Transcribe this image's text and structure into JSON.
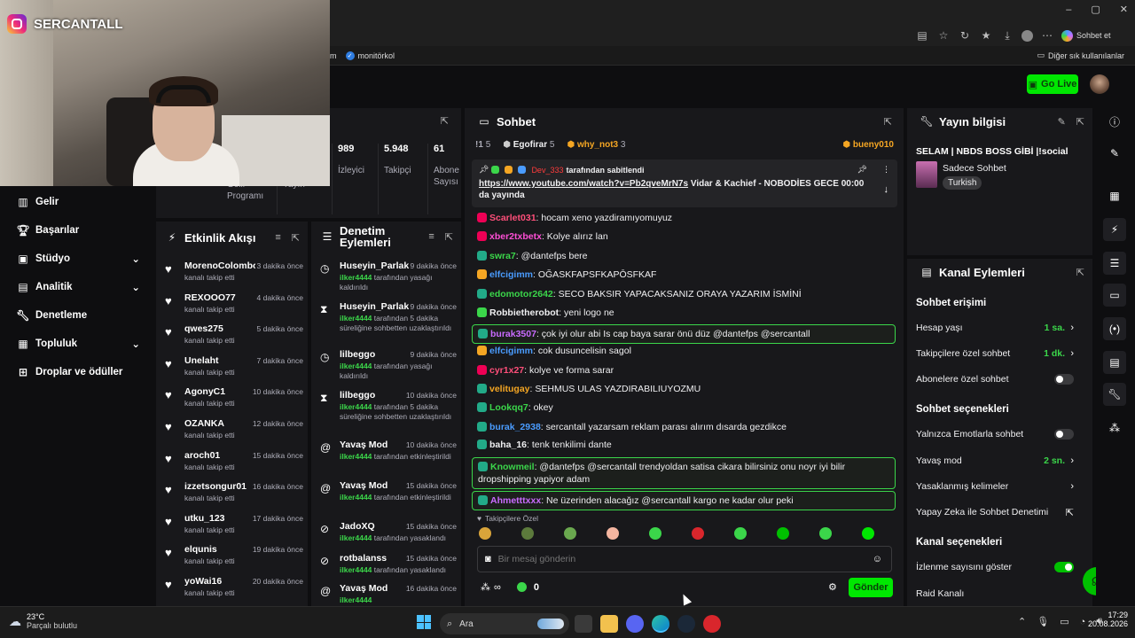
{
  "browser": {
    "window_controls": [
      "–",
      "▢",
      "✕"
    ],
    "chat_button": "Sohbet et",
    "bookmark_partial": "m",
    "bookmark_1": "monitörkol",
    "other_bookmarks": "Diğer sık kullanılanlar"
  },
  "overlay": {
    "instagram_handle": "SERCANTALL"
  },
  "header": {
    "go_live": "Go Live"
  },
  "nav": {
    "items": [
      {
        "label": "Gelir",
        "icon": "chart-icon",
        "chevron": false
      },
      {
        "label": "Başarılar",
        "icon": "trophy-icon",
        "chevron": false
      },
      {
        "label": "Stüdyo",
        "icon": "studio-icon",
        "chevron": true
      },
      {
        "label": "Analitik",
        "icon": "analytics-icon",
        "chevron": true
      },
      {
        "label": "Denetleme",
        "icon": "wrench-icon",
        "chevron": false
      },
      {
        "label": "Topluluk",
        "icon": "community-icon",
        "chevron": true
      },
      {
        "label": "Droplar ve ödüller",
        "icon": "gift-icon",
        "chevron": false
      }
    ]
  },
  "stats": {
    "partial_left_1": "Gelir\nProgramı",
    "partial_left_2": "Yayın",
    "viewers": {
      "value": "989",
      "label": "İzleyici"
    },
    "followers": {
      "value": "5.948",
      "label": "Takipçi"
    },
    "subs": {
      "value": "61",
      "label": "Abone\nSayısı"
    }
  },
  "activity": {
    "title": "Etkinlik Akışı",
    "items": [
      {
        "user": "MorenoColombo",
        "time": "3 dakika önce",
        "sub": "kanalı takip etti"
      },
      {
        "user": "REXOOO77",
        "time": "4 dakika önce",
        "sub": "kanalı takip etti"
      },
      {
        "user": "qwes275",
        "time": "5 dakika önce",
        "sub": "kanalı takip etti"
      },
      {
        "user": "Unelaht",
        "time": "7 dakika önce",
        "sub": "kanalı takip etti"
      },
      {
        "user": "AgonyC1",
        "time": "10 dakika önce",
        "sub": "kanalı takip etti"
      },
      {
        "user": "OZANKA",
        "time": "12 dakika önce",
        "sub": "kanalı takip etti"
      },
      {
        "user": "aroch01",
        "time": "15 dakika önce",
        "sub": "kanalı takip etti"
      },
      {
        "user": "izzetsongur01",
        "time": "16 dakika önce",
        "sub": "kanalı takip etti"
      },
      {
        "user": "utku_123",
        "time": "17 dakika önce",
        "sub": "kanalı takip etti"
      },
      {
        "user": "elqunis",
        "time": "19 dakika önce",
        "sub": "kanalı takip etti"
      },
      {
        "user": "yoWai16",
        "time": "20 dakika önce",
        "sub": "kanalı takip etti"
      }
    ]
  },
  "modlog": {
    "title": "Denetim Eylemleri",
    "items": [
      {
        "icon": "clock-icon",
        "user": "Huseyin_Parlak",
        "time": "9 dakika önce",
        "actor": "ilker4444",
        "text": " tarafından yasağı kaldırıldı"
      },
      {
        "icon": "hourglass-icon",
        "user": "Huseyin_Parlak",
        "time": "9 dakika önce",
        "actor": "ilker4444",
        "text": " tarafından 5 dakika süreliğine sohbetten uzaklaştırıldı"
      },
      {
        "icon": "clock-icon",
        "user": "lilbeggo",
        "time": "9 dakika önce",
        "actor": "ilker4444",
        "text": " tarafından yasağı kaldırıldı"
      },
      {
        "icon": "hourglass-icon",
        "user": "lilbeggo",
        "time": "10 dakika önce",
        "actor": "ilker4444",
        "text": " tarafından 5 dakika süreliğine sohbetten uzaklaştırıldı"
      },
      {
        "icon": "snail-icon",
        "user": "Yavaş Mod",
        "time": "10 dakika önce",
        "actor": "ilker4444",
        "text": " tarafından etkinleştirildi"
      },
      {
        "icon": "snail-icon",
        "user": "Yavaş Mod",
        "time": "15 dakika önce",
        "actor": "ilker4444",
        "text": " tarafından etkinleştirildi"
      },
      {
        "icon": "ban-icon",
        "user": "JadoXQ",
        "time": "15 dakika önce",
        "actor": "ilker4444",
        "text": " tarafından yasaklandı"
      },
      {
        "icon": "ban-icon",
        "user": "rotbalanss",
        "time": "15 dakika önce",
        "actor": "ilker4444",
        "text": " tarafından yasaklandı"
      },
      {
        "icon": "snail-icon",
        "user": "Yavaş Mod",
        "time": "16 dakika önce",
        "actor": "ilker4444",
        "text": ""
      }
    ]
  },
  "chat": {
    "title": "Sohbet",
    "gifters": [
      {
        "name": "!1",
        "count": "5",
        "color": "#adadb8"
      },
      {
        "name": "Egofirar",
        "count": "5",
        "color": "#efeff1"
      },
      {
        "name": "why_not3",
        "count": "3",
        "color": "#f5a623"
      },
      {
        "name": "bueny010",
        "count": "",
        "color": "#f5a623"
      }
    ],
    "pinned": {
      "by_user": "Dev_333",
      "by_text": " tarafından sabitlendi",
      "link": "https://www.youtube.com/watch?v=Pb2qveMrN7s",
      "message": " Vidar & Kachief - NOBODİES GECE 00:00 da yayında"
    },
    "messages": [
      {
        "user": "Scarlet031",
        "color": "#ff4f7a",
        "badge": "#e05",
        "text": ": hocam xeno yazdiramıyomuyuz",
        "highlight": false
      },
      {
        "user": "xber2txbetx",
        "color": "#ff4fd6",
        "badge": "#e05",
        "text": ": Kolye alırız lan",
        "highlight": false
      },
      {
        "user": "swra7",
        "color": "#3bd64a",
        "badge": "#2a8",
        "text": ": @dantefps bere",
        "highlight": false
      },
      {
        "user": "elfcigimm",
        "color": "#4a9cff",
        "badge": "#f5a623",
        "text": ": OĞASKFAPSFKAPŌSFKAF",
        "highlight": false
      },
      {
        "user": "edomotor2642",
        "color": "#3bd64a",
        "badge": "#2a8",
        "text": ": SECO BAKSIR YAPACAKSANIZ ORAYA YAZARIM İSMİNİ",
        "highlight": false
      },
      {
        "user": "Robbietherobot",
        "color": "#efeff1",
        "badge": "#3bd64a",
        "text": ": yeni logo ne",
        "highlight": false
      },
      {
        "user": "burak3507",
        "color": "#c96bff",
        "badge": "#2a8",
        "text": ": çok iyi olur abi Is cap baya sarar önü düz @dantefps @sercantall",
        "highlight": true
      },
      {
        "user": "elfcigimm",
        "color": "#4a9cff",
        "badge": "#f5a623",
        "text": ": cok dusuncelisin sagol",
        "highlight": false
      },
      {
        "user": "cyr1x27",
        "color": "#ff4f7a",
        "badge": "#e05",
        "text": ": kolye ve forma sarar",
        "highlight": false
      },
      {
        "user": "velitugay",
        "color": "#f5a623",
        "badge": "#2a8",
        "text": ": SEHMUS ULAS YAZDIRABILIUYOZMU",
        "highlight": false
      },
      {
        "user": "Lookqq7",
        "color": "#3bd64a",
        "badge": "#2a8",
        "text": ": okey",
        "highlight": false
      },
      {
        "user": "burak_2938",
        "color": "#4a9cff",
        "badge": "#2a8",
        "text": ": sercantall yazarsam reklam parası alırım dısarda gezdikce",
        "highlight": false
      },
      {
        "user": "baha_16",
        "color": "#efeff1",
        "badge": "#2a8",
        "text": ": tenk tenkilimi dante",
        "highlight": false
      },
      {
        "user": "Knowmeil",
        "color": "#3bd64a",
        "badge": "#2a8",
        "text": ": @dantefps @sercantall trendyoldan satisa cikara bilirsiniz onu noyr iyi bilir dropshipping yapiyor adam",
        "highlight": true
      },
      {
        "user": "Ahmetttxxx",
        "color": "#c96bff",
        "badge": "#2a8",
        "text": ": Ne üzerinden alacağız @sercantall kargo ne kadar olur peki",
        "highlight": true
      }
    ],
    "emote_tab": "Takipçilere Özel",
    "input_placeholder": "Bir mesaj gönderin",
    "points_infinite": "∞",
    "points_value": "0",
    "send": "Gönder"
  },
  "streaminfo": {
    "title": "Yayın bilgisi",
    "stream_title": "SELAM | NBDS BOSS GİBİ |!social",
    "category": "Sadece Sohbet",
    "tag": "Turkish"
  },
  "channel_actions": {
    "title": "Kanal Eylemleri",
    "section_access": "Sohbet erişimi",
    "account_age": {
      "label": "Hesap yaşı",
      "value": "1 sa."
    },
    "followers_only": {
      "label": "Takipçilere özel sohbet",
      "value": "1 dk."
    },
    "subs_only": {
      "label": "Abonelere özel sohbet",
      "on": false
    },
    "section_options": "Sohbet seçenekleri",
    "emote_only": {
      "label": "Yalnızca Emotlarla sohbet",
      "on": false
    },
    "slow_mode": {
      "label": "Yavaş mod",
      "value": "2 sn."
    },
    "banned_words": {
      "label": "Yasaklanmış kelimeler"
    },
    "ai_mod": {
      "label": "Yapay Zeka ile Sohbet Denetimi"
    },
    "section_channel": "Kanal seçenekleri",
    "show_viewers": {
      "label": "İzlenme sayısını göster",
      "on": true
    },
    "raid": {
      "label": "Raid Kanalı"
    }
  },
  "taskbar": {
    "weather_temp": "23°C",
    "weather_desc": "Parçalı bulutlu",
    "search": "Ara",
    "time": "17:29",
    "date": "20.08.2026"
  },
  "colors": {
    "accent": "#00e701",
    "bg": "#0e0e10",
    "panel": "#18181b"
  }
}
